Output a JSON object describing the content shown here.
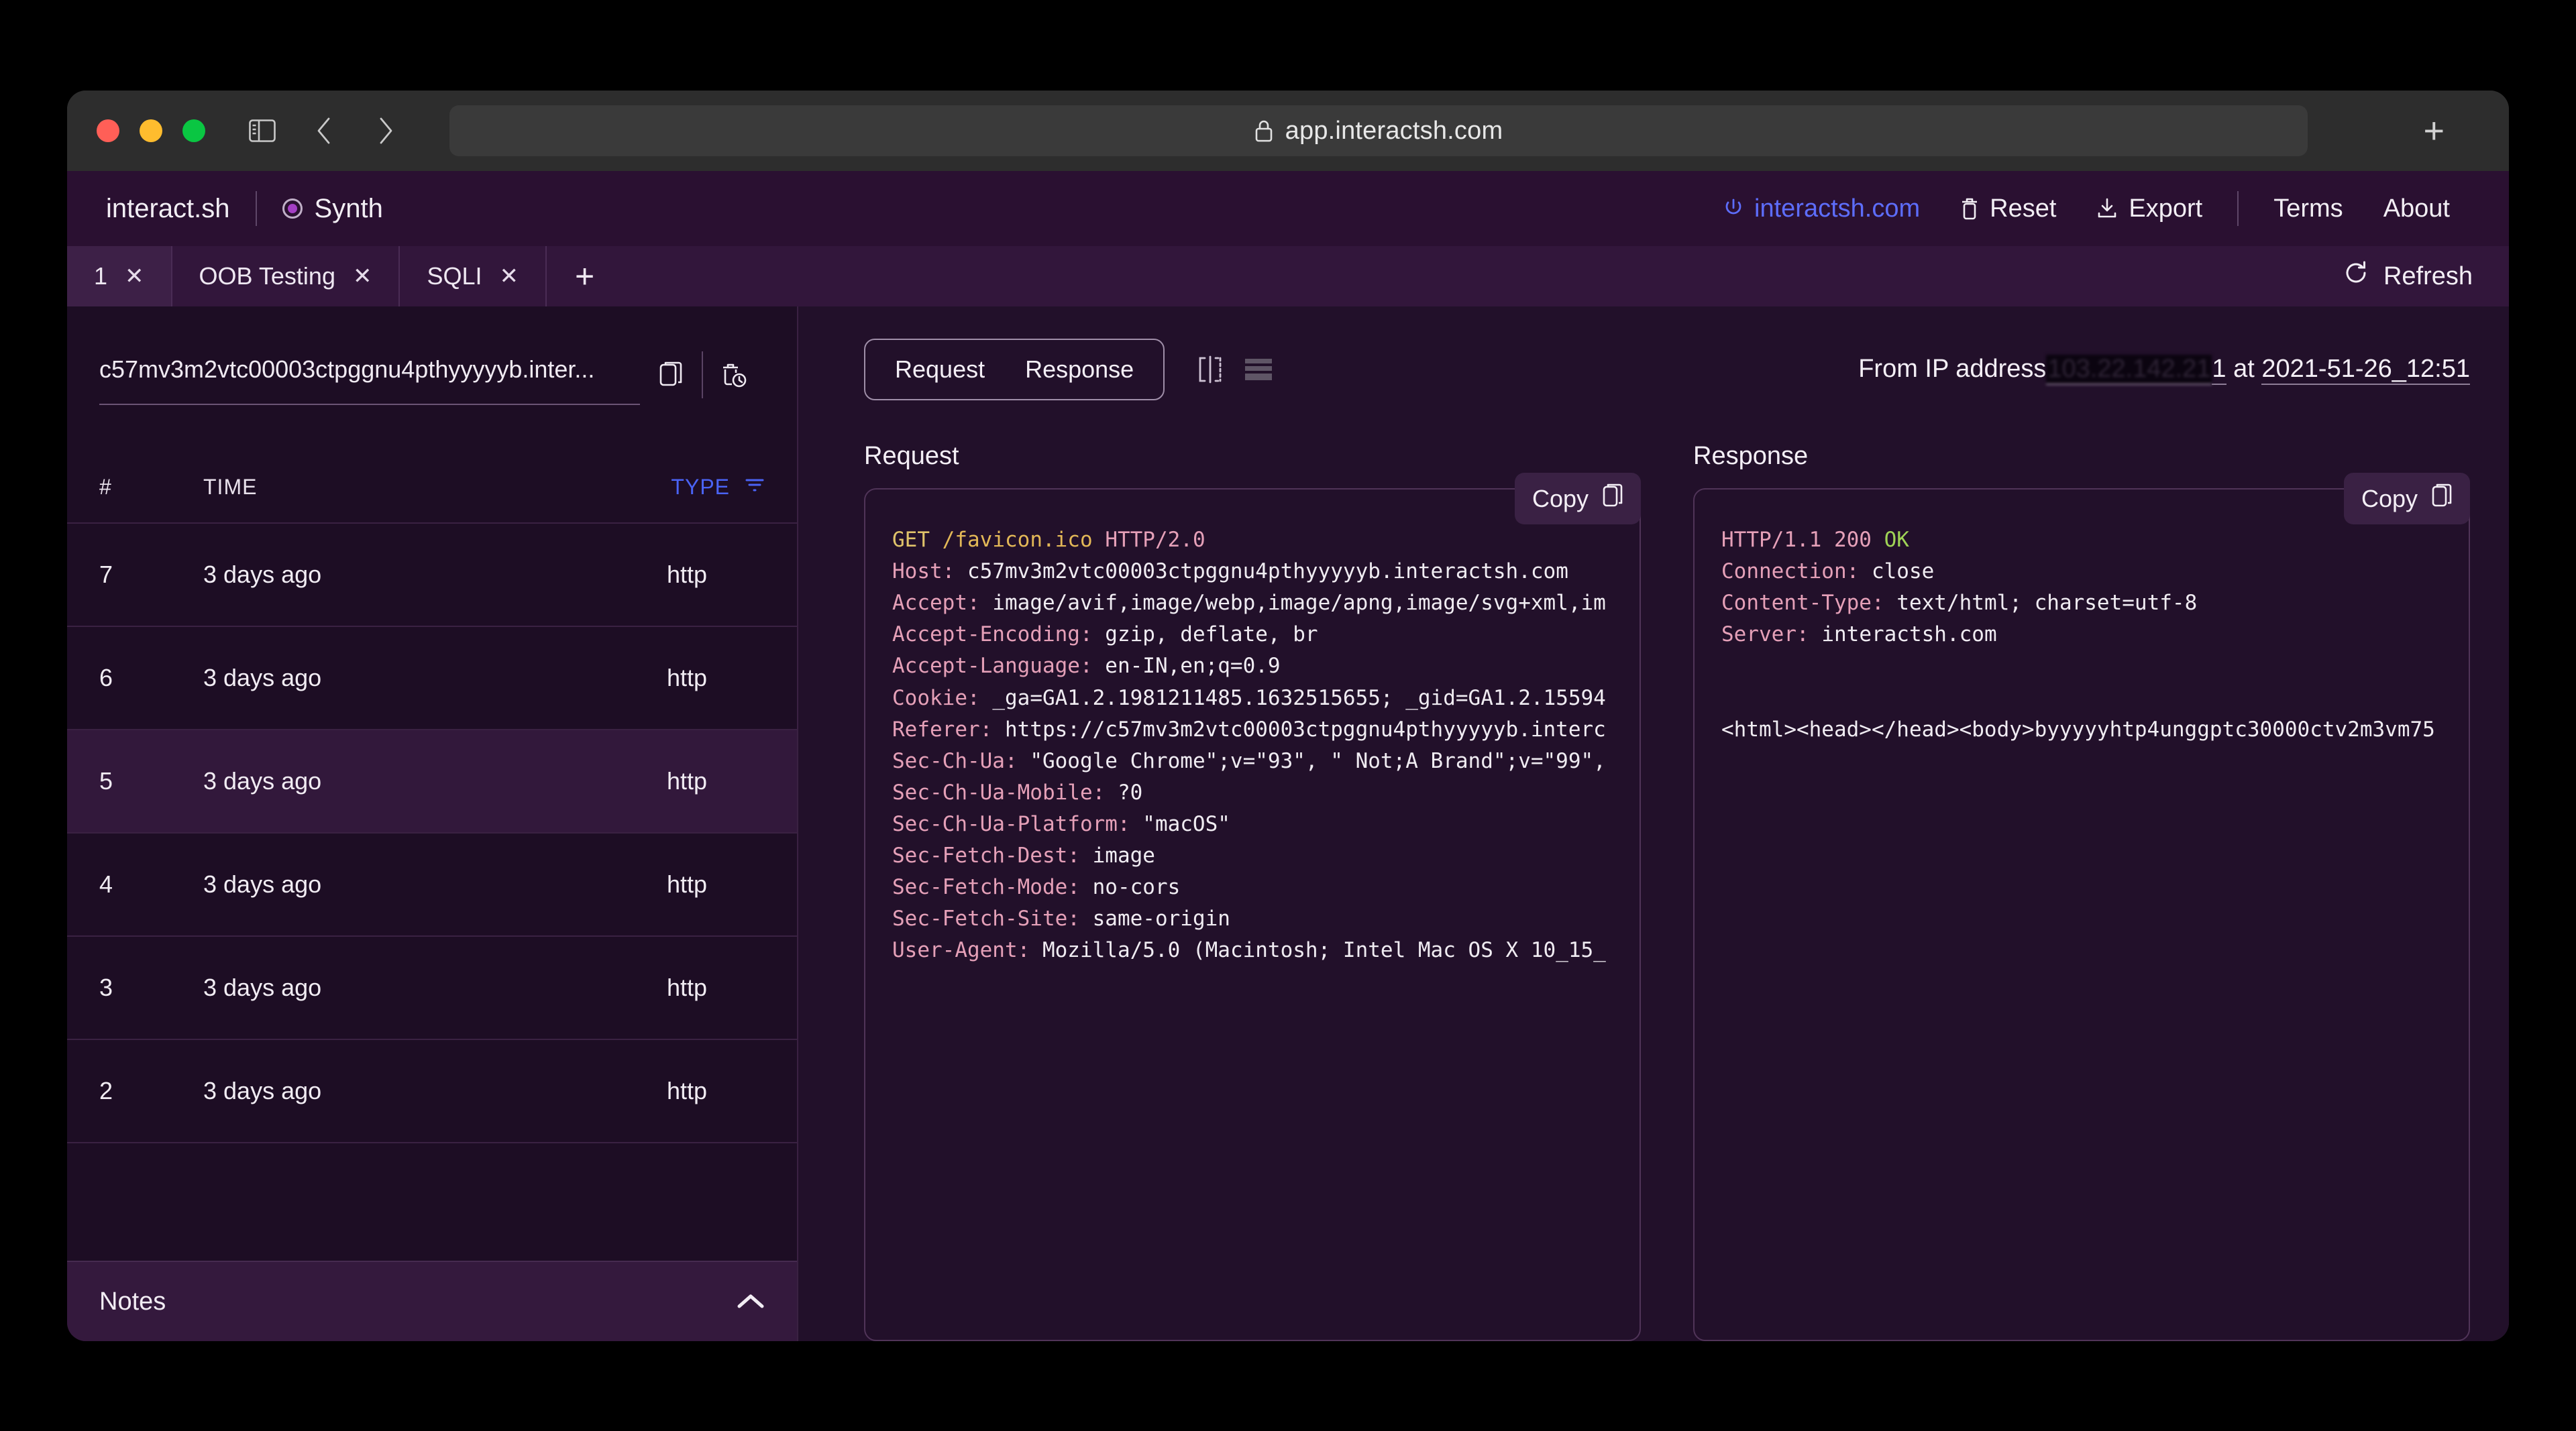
{
  "browser": {
    "url": "app.interactsh.com",
    "lock_icon": "lock-icon",
    "sidebar_icon": "sidebar-toggle-icon",
    "back_icon": "chevron-left-icon",
    "forward_icon": "chevron-right-icon",
    "new_tab_label": "+"
  },
  "header": {
    "brand": "interact.sh",
    "synth_label": "Synth",
    "links": [
      {
        "label": "interactsh.com",
        "icon": "power-icon",
        "is_link": true
      },
      {
        "label": "Reset",
        "icon": "trash-icon",
        "is_link": false
      },
      {
        "label": "Export",
        "icon": "download-icon",
        "is_link": false
      },
      {
        "label": "Terms",
        "icon": "",
        "is_link": false
      },
      {
        "label": "About",
        "icon": "",
        "is_link": false
      }
    ]
  },
  "tabs": {
    "items": [
      {
        "label": "1",
        "active": true
      },
      {
        "label": "OOB Testing",
        "active": false
      },
      {
        "label": "SQLI",
        "active": false
      }
    ],
    "close_glyph": "✕",
    "add_label": "+",
    "refresh_label": "Refresh"
  },
  "sidebar": {
    "domain": "c57mv3m2vtc00003ctpggnu4pthyyyyyb.inter...",
    "copy_icon": "copy-icon",
    "clear_history_icon": "delete-history-icon",
    "columns": {
      "num": "#",
      "time": "TIME",
      "type": "TYPE"
    },
    "filter_icon": "filter-icon",
    "rows": [
      {
        "num": "7",
        "time": "3 days ago",
        "type": "http",
        "selected": false
      },
      {
        "num": "6",
        "time": "3 days ago",
        "type": "http",
        "selected": false
      },
      {
        "num": "5",
        "time": "3 days ago",
        "type": "http",
        "selected": true
      },
      {
        "num": "4",
        "time": "3 days ago",
        "type": "http",
        "selected": false
      },
      {
        "num": "3",
        "time": "3 days ago",
        "type": "http",
        "selected": false
      },
      {
        "num": "2",
        "time": "3 days ago",
        "type": "http",
        "selected": false
      }
    ],
    "notes_label": "Notes",
    "notes_chevron": "chevron-up-icon"
  },
  "main": {
    "segment": {
      "request": "Request",
      "response": "Response"
    },
    "view_icons": [
      "split-view-icon",
      "list-view-icon"
    ],
    "meta": {
      "prefix": "From IP address",
      "ip_redacted": "103.22.142.21",
      "ip_visible_suffix": "1",
      "at": "at",
      "timestamp": "2021-51-26_12:51"
    },
    "request_panel": {
      "title": "Request",
      "copy_label": "Copy",
      "copy_icon": "copy-icon",
      "lines": [
        {
          "method": "GET",
          "path": "/favicon.ico",
          "proto": "HTTP/2.0"
        },
        {
          "key": "Host:",
          "value": "c57mv3m2vtc00003ctpggnu4pthyyyyyb.interactsh.com"
        },
        {
          "key": "Accept:",
          "value": "image/avif,image/webp,image/apng,image/svg+xml,im"
        },
        {
          "key": "Accept-Encoding:",
          "value": "gzip, deflate, br"
        },
        {
          "key": "Accept-Language:",
          "value": "en-IN,en;q=0.9"
        },
        {
          "key": "Cookie:",
          "value": "_ga=GA1.2.1981211485.1632515655; _gid=GA1.2.15594"
        },
        {
          "key": "Referer:",
          "value": "https://c57mv3m2vtc00003ctpggnu4pthyyyyyb.interc"
        },
        {
          "key": "Sec-Ch-Ua:",
          "value": "\"Google Chrome\";v=\"93\", \" Not;A Brand\";v=\"99\","
        },
        {
          "key": "Sec-Ch-Ua-Mobile:",
          "value": "?0"
        },
        {
          "key": "Sec-Ch-Ua-Platform:",
          "value": "\"macOS\""
        },
        {
          "key": "Sec-Fetch-Dest:",
          "value": "image"
        },
        {
          "key": "Sec-Fetch-Mode:",
          "value": "no-cors"
        },
        {
          "key": "Sec-Fetch-Site:",
          "value": "same-origin"
        },
        {
          "key": "User-Agent:",
          "value": "Mozilla/5.0 (Macintosh; Intel Mac OS X 10_15_"
        }
      ]
    },
    "response_panel": {
      "title": "Response",
      "copy_label": "Copy",
      "copy_icon": "copy-icon",
      "status_proto": "HTTP/1.1 200",
      "status_text": "OK",
      "lines": [
        {
          "key": "Connection:",
          "value": "close"
        },
        {
          "key": "Content-Type:",
          "value": "text/html; charset=utf-8"
        },
        {
          "key": "Server:",
          "value": "interactsh.com"
        }
      ],
      "body": "<html><head></head><body>byyyyyhtp4unggptc30000ctv2m3vm75"
    }
  },
  "colors": {
    "app_bg": "#22102a",
    "sidebar_bg": "#1d0d24",
    "header_bg": "#2a1031",
    "tabbar_bg": "#32163b",
    "accent_blue": "#4a63f5",
    "link_blue": "#5d6dfb",
    "key_pink": "#e5a0b8",
    "ok_green": "#9fd356",
    "method_yellow": "#e0c36a"
  }
}
